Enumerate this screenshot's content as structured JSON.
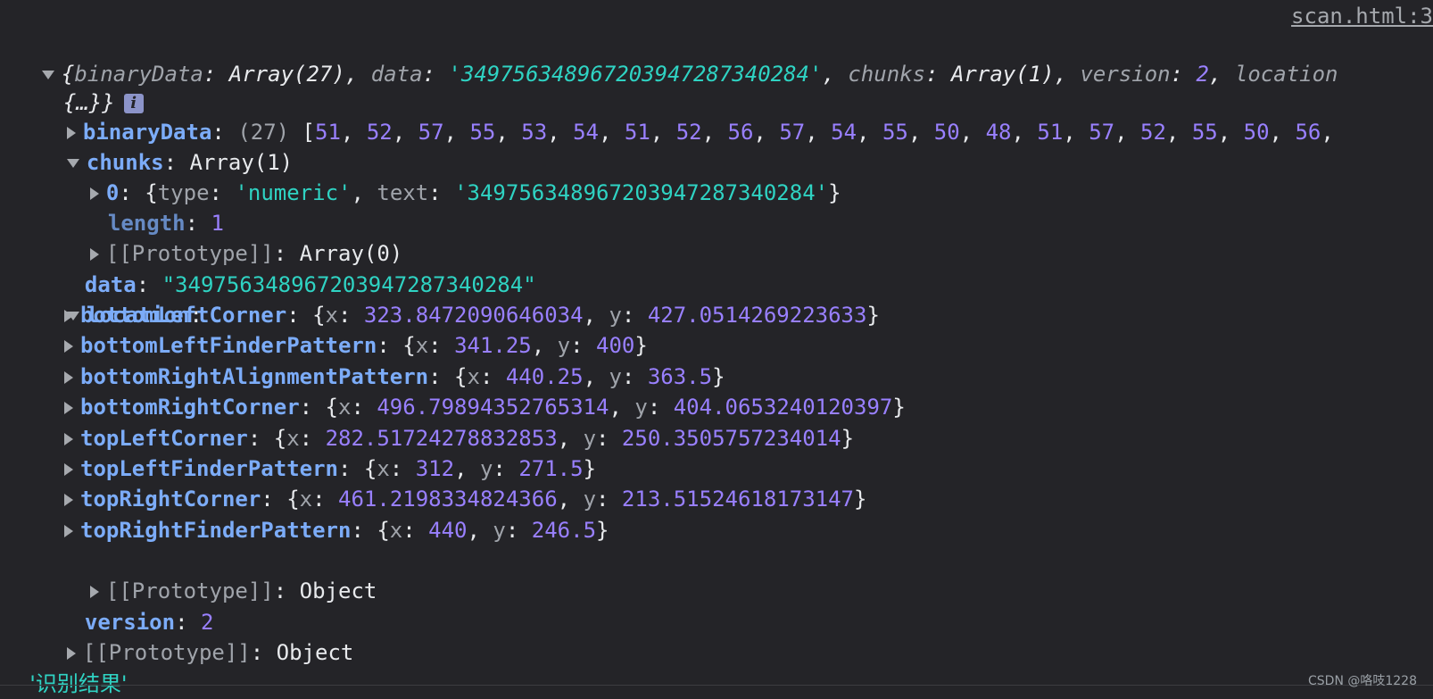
{
  "source_link": "scan.html:3",
  "summary": {
    "open": "{",
    "binary_key": "binaryData",
    "binary_val": "Array(27)",
    "data_key": "data",
    "data_val": "'34975634896720394728734 0284'",
    "chunks_key": "chunks",
    "chunks_val": "Array(1)",
    "version_key": "version",
    "version_val": "2",
    "location_key": "location",
    "line2": "{…}}",
    "info_icon": "i"
  },
  "binaryData": {
    "key": "binaryData",
    "count": "(27)",
    "values": [
      "51",
      "52",
      "57",
      "55",
      "53",
      "54",
      "51",
      "52",
      "56",
      "57",
      "54",
      "55",
      "50",
      "48",
      "51",
      "57",
      "52",
      "55",
      "50",
      "56"
    ]
  },
  "chunks": {
    "key": "chunks",
    "type_label": "Array(1)",
    "item0": {
      "index": "0",
      "type_key": "type",
      "type_val": "'numeric'",
      "text_key": "text",
      "text_val": "'3497563489672039472873402 84'"
    },
    "length_key": "length",
    "length_val": "1",
    "proto_key": "[[Prototype]]",
    "proto_val": "Array(0)"
  },
  "data": {
    "key": "data",
    "value": "\"3497563489672039472873402 84\""
  },
  "location": {
    "key": "location",
    "items": [
      {
        "key": "bottomLeftCorner",
        "x": "323.8472090646034",
        "y": "427.0514269223633"
      },
      {
        "key": "bottomLeftFinderPattern",
        "x": "341.25",
        "y": "400"
      },
      {
        "key": "bottomRightAlignmentPattern",
        "x": "440.25",
        "y": "363.5"
      },
      {
        "key": "bottomRightCorner",
        "x": "496.79894352765314",
        "y": "404.0653240120397"
      },
      {
        "key": "topLeftCorner",
        "x": "282.51724278832853",
        "y": "250.3505757234014"
      },
      {
        "key": "topLeftFinderPattern",
        "x": "312",
        "y": "271.5"
      },
      {
        "key": "topRightCorner",
        "x": "461.2198334824366",
        "y": "213.51524618173147"
      },
      {
        "key": "topRightFinderPattern",
        "x": "440",
        "y": "246.5"
      }
    ],
    "proto_key": "[[Prototype]]",
    "proto_val": "Object"
  },
  "version": {
    "key": "version",
    "value": "2"
  },
  "root_proto": {
    "key": "[[Prototype]]",
    "value": "Object"
  },
  "result_string": "'识别结果'",
  "watermark": "CSDN @咯吱1228"
}
